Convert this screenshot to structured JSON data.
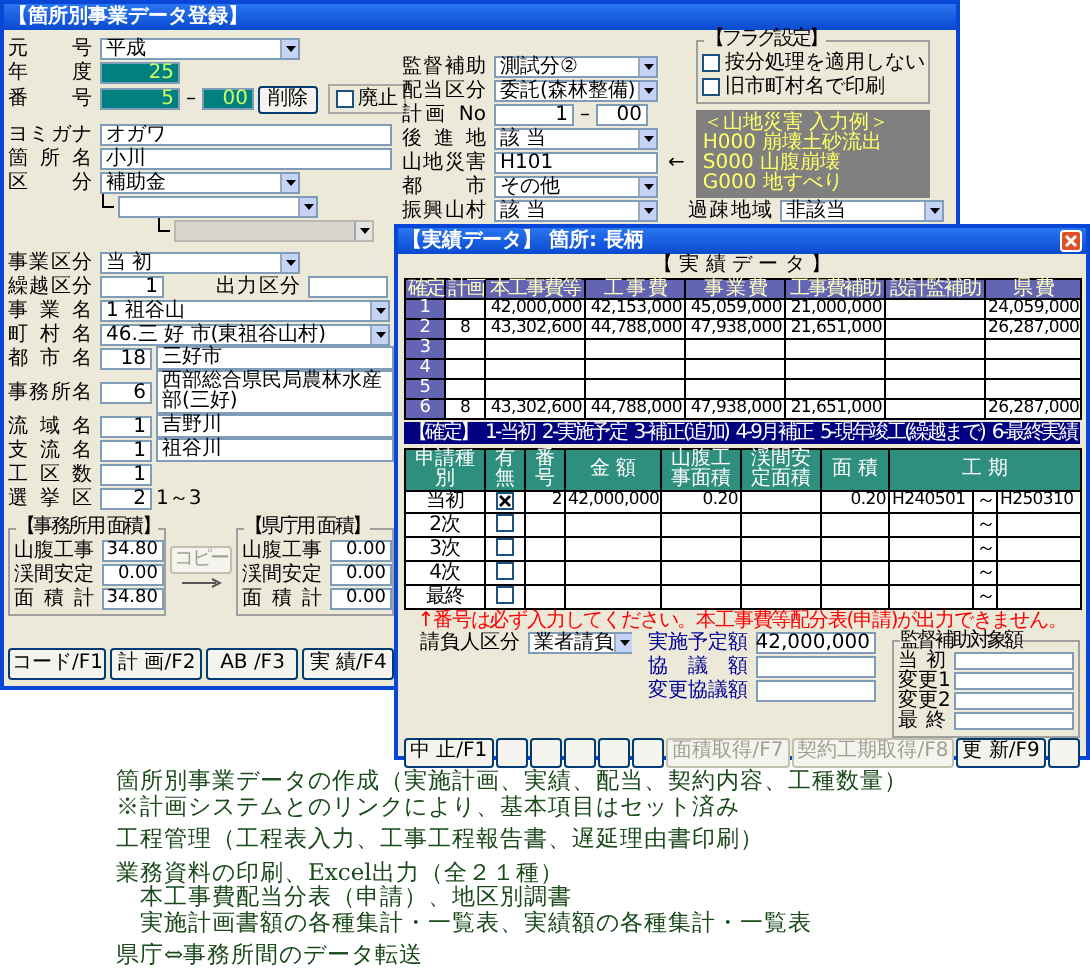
{
  "main_window": {
    "title": "【箇所別事業データ登録】",
    "header_rows": [
      {
        "kind": "select",
        "label": "元号",
        "value": "平成"
      },
      {
        "kind": "teal",
        "label": "年度",
        "value": "25"
      },
      {
        "kind": "number",
        "label": "番号",
        "value": "5",
        "dash": "–",
        "suffix": "00",
        "button": "削除",
        "checkbox": {
          "label": "廃止",
          "checked": false
        }
      }
    ],
    "name_rows": [
      {
        "kind": "text",
        "label": "ヨミガナ",
        "value": "オガワ"
      },
      {
        "kind": "text",
        "label": "箇所名",
        "value": "小川"
      },
      {
        "kind": "select",
        "label": "区分",
        "value": "補助金"
      },
      {
        "kind": "subselect",
        "disabled": false
      },
      {
        "kind": "subselect",
        "disabled": true
      }
    ],
    "detail_rows": [
      {
        "kind": "select",
        "label": "事業区分",
        "value": "当 初"
      },
      {
        "kind": "pair",
        "label": "繰越区分",
        "value": "1",
        "label2": "出力区分"
      },
      {
        "kind": "wide_select",
        "label": "事業名",
        "value": "1 祖谷山"
      },
      {
        "kind": "wide_select",
        "label": "町村名",
        "value": "46.三 好 市(東祖谷山村)"
      },
      {
        "kind": "code_name",
        "label": "都市名",
        "code": "18",
        "value": "三好市"
      },
      {
        "kind": "code_name",
        "label": "事務所名",
        "code": "6",
        "value": "西部総合県民局農林水産部(三好)"
      },
      {
        "kind": "code_name",
        "label": "流域名",
        "code": "1",
        "value": "吉野川"
      },
      {
        "kind": "code_name",
        "label": "支流名",
        "code": "1",
        "value": "祖谷川"
      },
      {
        "kind": "short",
        "label": "工区数",
        "value": "1"
      },
      {
        "kind": "short",
        "label": "選挙区",
        "value": "2",
        "note": "1～3"
      }
    ],
    "area_groups": [
      {
        "title": "【事務所用 面積】",
        "rows": [
          {
            "label": "山腹工事",
            "value": "34.80"
          },
          {
            "label": "渓間安定",
            "value": "0.00"
          },
          {
            "label": "面積計",
            "value": "34.80"
          }
        ]
      },
      {
        "title": "【県庁用 面積】",
        "rows": [
          {
            "label": "山腹工事",
            "value": "0.00"
          },
          {
            "label": "渓間安定",
            "value": "0.00"
          },
          {
            "label": "面積計",
            "value": "0.00"
          }
        ]
      }
    ],
    "copy_button": {
      "label": "コピー",
      "disabled": true
    },
    "function_buttons": [
      "コード/F1",
      "計 画/F2",
      "AB /F3",
      "実 績/F4"
    ],
    "right_rows": [
      {
        "kind": "select",
        "label": "監督補助",
        "value": "測試分②"
      },
      {
        "kind": "select",
        "label": "配当区分",
        "value": "委託(森林整備)"
      },
      {
        "kind": "range",
        "label": "計画 No",
        "value": "1",
        "dash": "–",
        "suffix": "00"
      },
      {
        "kind": "select",
        "label": "後進地",
        "value": "該 当"
      },
      {
        "kind": "text",
        "label": "山地災害",
        "value": "H101",
        "arrow": "←"
      },
      {
        "kind": "select",
        "label": "都市",
        "value": "その他"
      },
      {
        "kind": "select",
        "label": "振興山村",
        "value": "該 当"
      }
    ],
    "depopulated": {
      "label": "過疎地域",
      "value": "非該当"
    },
    "flags": {
      "title": "【フラグ設定】",
      "items": [
        {
          "label": "按分処理を適用しない",
          "checked": false
        },
        {
          "label": "旧市町村名で印刷",
          "checked": false
        }
      ]
    },
    "hint_box": [
      "＜山地災害 入力例＞",
      "H000 崩壊土砂流出",
      "S000 山腹崩壊",
      "G000 地すべり"
    ]
  },
  "results_window": {
    "title": "【実績データ】 箇所: 長柄",
    "heading": "【 実 績 デ ー タ 】",
    "table": {
      "columns": [
        "確定",
        "計画",
        "本工事費等",
        "工 事 費",
        "事 業 費",
        "工事費補助",
        "設計監補助",
        "県 費"
      ],
      "rows": [
        {
          "confirm": "1",
          "main_cost": "42,000,000",
          "construction": "42,153,000",
          "project": "45,059,000",
          "subsidy": "21,000,000",
          "prefecture": "24,059,000"
        },
        {
          "confirm": "2",
          "plan": "8",
          "main_cost": "43,302,600",
          "construction": "44,788,000",
          "project": "47,938,000",
          "subsidy": "21,651,000",
          "prefecture": "26,287,000"
        },
        {
          "confirm": "3"
        },
        {
          "confirm": "4"
        },
        {
          "confirm": "5"
        },
        {
          "confirm": "6",
          "plan": "8",
          "main_cost": "43,302,600",
          "construction": "44,788,000",
          "project": "47,938,000",
          "subsidy": "21,651,000",
          "prefecture": "26,287,000"
        }
      ]
    },
    "legend": [
      "【確定】",
      "1-当初",
      "2-実施予定",
      "3-補正(追加)",
      "4-9月補正",
      "5-現年竣工(繰越まで)",
      "6-最終実績"
    ],
    "applications": {
      "columns": [
        "申請種別",
        "有無",
        "番号",
        "金 額",
        "山腹工事面積",
        "渓間安定面積",
        "面 積",
        "工 期"
      ],
      "rows": [
        {
          "type": "当初",
          "checked": true,
          "number": "2",
          "amount": "42,000,000",
          "hillside": "0.20",
          "area": "0.20",
          "from": "H240501",
          "tilde": "～",
          "to": "H250310"
        },
        {
          "type": "2次",
          "checked": false,
          "tilde": "～"
        },
        {
          "type": "3次",
          "checked": false,
          "tilde": "～"
        },
        {
          "type": "4次",
          "checked": false,
          "tilde": "～"
        },
        {
          "type": "最終",
          "checked": false,
          "tilde": "～"
        }
      ]
    },
    "note": "↑番号は必ず入力してください。本工事費等配分表(申請)が出力できません。",
    "contractor": {
      "label": "請負人区分",
      "value": "業者請負"
    },
    "amounts": [
      {
        "label": "実施予定額",
        "value": "42,000,000"
      },
      {
        "label": "協議額"
      },
      {
        "label": "変更協議額"
      }
    ],
    "supervision": {
      "title": "監督補助対象額",
      "rows": [
        {
          "label": "当初"
        },
        {
          "label": "変更1"
        },
        {
          "label": "変更2"
        },
        {
          "label": "最終"
        }
      ]
    },
    "buttons": [
      {
        "kind": "label",
        "label": "中 止/F1",
        "disabled": false
      },
      {
        "kind": "blank"
      },
      {
        "kind": "blank"
      },
      {
        "kind": "blank"
      },
      {
        "kind": "blank"
      },
      {
        "kind": "blank"
      },
      {
        "kind": "label",
        "label": "面積取得/F7",
        "disabled": true
      },
      {
        "kind": "label",
        "label": "契約工期取得/F8",
        "disabled": true
      },
      {
        "kind": "label",
        "label": "更 新/F9",
        "disabled": false
      },
      {
        "kind": "blank"
      }
    ]
  },
  "description": [
    {
      "lines": [
        "箇所別事業データの作成（実施計画、実績、配当、契約内容、工種数量）",
        "※計画システムとのリンクにより、基本項目はセット済み"
      ]
    },
    {
      "lines": [
        "工程管理（工程表入力、工事工程報告書、遅延理由書印刷）"
      ]
    },
    {
      "lines": [
        "業務資料の印刷、Excel出力（全２１種）"
      ],
      "children": [
        "本工事費配当分表（申請）、地区別調書",
        "実施計画書額の各種集計・一覧表、実績額の各種集計・一覧表"
      ]
    },
    {
      "lines": [
        "県庁⇔事務所間のデータ転送"
      ]
    }
  ]
}
